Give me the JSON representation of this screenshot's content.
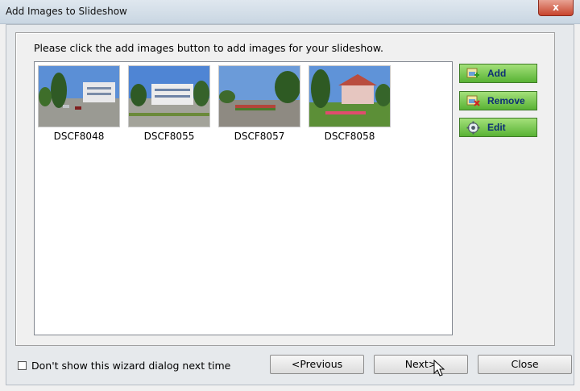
{
  "window": {
    "title": "Add Images to Slideshow",
    "close_glyph": "x"
  },
  "instruction": "Please click the add images button to add  images for your slideshow.",
  "images": [
    {
      "caption": "DSCF8048"
    },
    {
      "caption": "DSCF8055"
    },
    {
      "caption": "DSCF8057"
    },
    {
      "caption": "DSCF8058"
    }
  ],
  "side_buttons": {
    "add": {
      "label": "Add",
      "icon": "add-image-icon"
    },
    "remove": {
      "label": "Remove",
      "icon": "remove-image-icon"
    },
    "edit": {
      "label": "Edit",
      "icon": "gear-icon"
    }
  },
  "footer": {
    "checkbox_label": "Don't show this wizard dialog next time",
    "checkbox_checked": false,
    "previous_label": "<Previous",
    "next_label": "Next>",
    "close_label": "Close"
  },
  "colors": {
    "button_green": "#58b234",
    "button_text": "#0d2f74",
    "titlebar": "#c9d6e2",
    "close_red": "#c7442c"
  }
}
